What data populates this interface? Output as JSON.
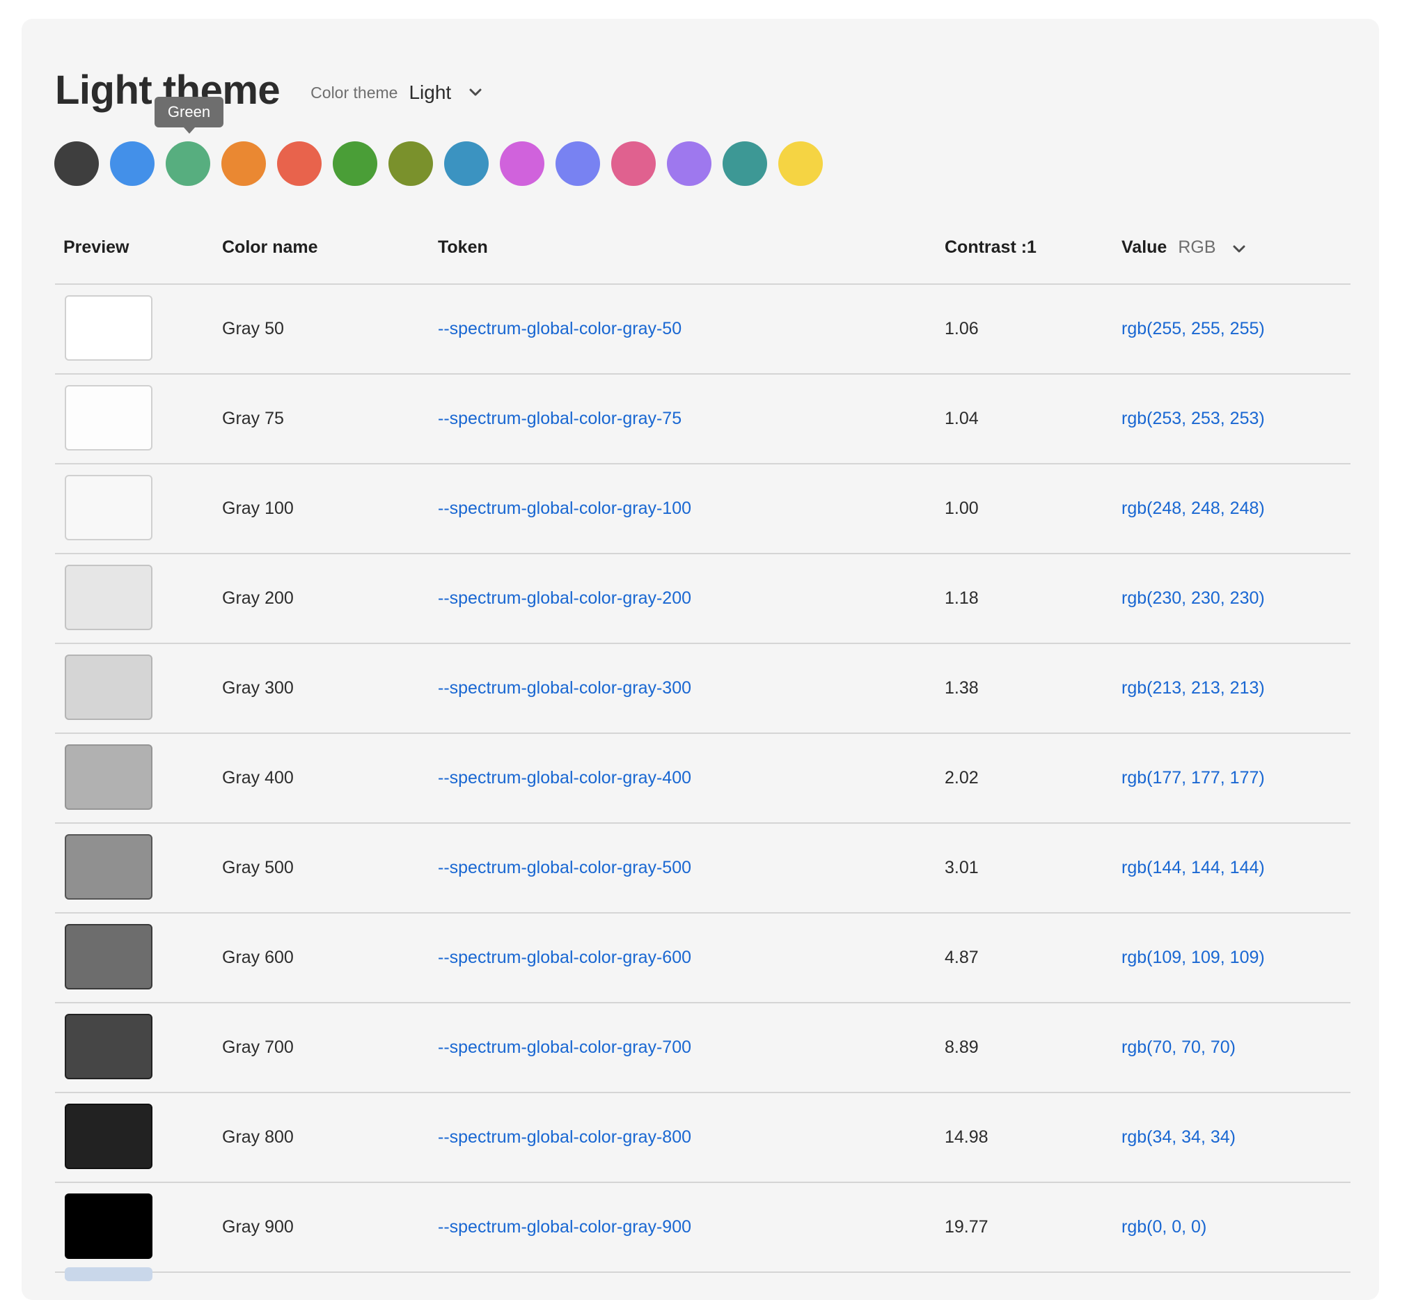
{
  "header": {
    "title": "Light theme",
    "theme_label": "Color theme",
    "theme_value": "Light"
  },
  "tooltip": {
    "text": "Green"
  },
  "swatches": [
    {
      "name": "gray",
      "color": "#3e3e3e"
    },
    {
      "name": "blue",
      "color": "#4390e9"
    },
    {
      "name": "green",
      "color": "#57ae7f"
    },
    {
      "name": "orange",
      "color": "#ea8832"
    },
    {
      "name": "red",
      "color": "#e8634c"
    },
    {
      "name": "celery",
      "color": "#4a9e37"
    },
    {
      "name": "chartreuse",
      "color": "#7a912c"
    },
    {
      "name": "seafoam",
      "color": "#3b93c1"
    },
    {
      "name": "magenta",
      "color": "#d062dc"
    },
    {
      "name": "indigo",
      "color": "#7882f2"
    },
    {
      "name": "fuchsia",
      "color": "#e0618f"
    },
    {
      "name": "purple",
      "color": "#9e78ee"
    },
    {
      "name": "teal",
      "color": "#3d9895"
    },
    {
      "name": "yellow",
      "color": "#f5d443"
    }
  ],
  "table": {
    "headers": {
      "preview": "Preview",
      "color_name": "Color name",
      "token": "Token",
      "contrast": "Contrast :1",
      "value": "Value",
      "value_format": "RGB"
    },
    "rows": [
      {
        "name": "Gray 50",
        "token": "--spectrum-global-color-gray-50",
        "contrast": "1.06",
        "value": "rgb(255, 255, 255)",
        "color": "#ffffff",
        "border": "#d0d0d0"
      },
      {
        "name": "Gray 75",
        "token": "--spectrum-global-color-gray-75",
        "contrast": "1.04",
        "value": "rgb(253, 253, 253)",
        "color": "#fdfdfd",
        "border": "#d0d0d0"
      },
      {
        "name": "Gray 100",
        "token": "--spectrum-global-color-gray-100",
        "contrast": "1.00",
        "value": "rgb(248, 248, 248)",
        "color": "#f8f8f8",
        "border": "#d0d0d0"
      },
      {
        "name": "Gray 200",
        "token": "--spectrum-global-color-gray-200",
        "contrast": "1.18",
        "value": "rgb(230, 230, 230)",
        "color": "#e6e6e6",
        "border": "#c4c4c4"
      },
      {
        "name": "Gray 300",
        "token": "--spectrum-global-color-gray-300",
        "contrast": "1.38",
        "value": "rgb(213, 213, 213)",
        "color": "#d5d5d5",
        "border": "#b4b4b4"
      },
      {
        "name": "Gray 400",
        "token": "--spectrum-global-color-gray-400",
        "contrast": "2.02",
        "value": "rgb(177, 177, 177)",
        "color": "#b1b1b1",
        "border": "#959595"
      },
      {
        "name": "Gray 500",
        "token": "--spectrum-global-color-gray-500",
        "contrast": "3.01",
        "value": "rgb(144, 144, 144)",
        "color": "#909090",
        "border": "#555555"
      },
      {
        "name": "Gray 600",
        "token": "--spectrum-global-color-gray-600",
        "contrast": "4.87",
        "value": "rgb(109, 109, 109)",
        "color": "#6d6d6d",
        "border": "#3a3a3a"
      },
      {
        "name": "Gray 700",
        "token": "--spectrum-global-color-gray-700",
        "contrast": "8.89",
        "value": "rgb(70, 70, 70)",
        "color": "#464646",
        "border": "#222222"
      },
      {
        "name": "Gray 800",
        "token": "--spectrum-global-color-gray-800",
        "contrast": "14.98",
        "value": "rgb(34, 34, 34)",
        "color": "#222222",
        "border": "#111111"
      },
      {
        "name": "Gray 900",
        "token": "--spectrum-global-color-gray-900",
        "contrast": "19.77",
        "value": "rgb(0, 0, 0)",
        "color": "#000000",
        "border": "#000000"
      }
    ]
  }
}
